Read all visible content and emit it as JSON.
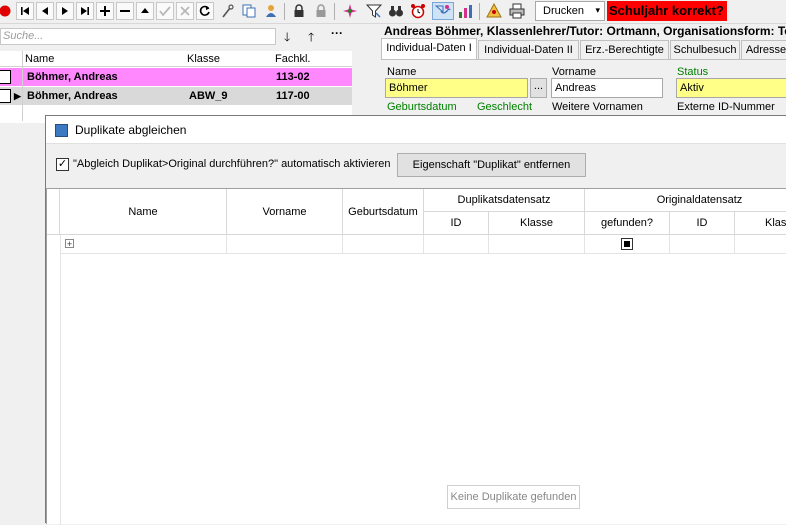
{
  "toolbar": {
    "print_label": "Drucken",
    "warning_text": "Schuljahr korrekt?",
    "icons": [
      "record-icon",
      "first-icon",
      "prev-icon",
      "next-icon",
      "last-icon",
      "add-icon",
      "delete-icon",
      "up-icon",
      "confirm-icon",
      "cancel-icon",
      "refresh-icon",
      "tools-icon",
      "copy-icon",
      "user-icon",
      "lock-icon",
      "lock-gray-icon",
      "sparkle-icon",
      "filter-icon",
      "binoculars-icon",
      "alarm-icon",
      "duplicate-icon",
      "chart-icon",
      "report-icon",
      "printer-icon",
      "dropdown-icon"
    ]
  },
  "left_panel": {
    "search_placeholder": "Suche...",
    "columns": {
      "name": "Name",
      "klasse": "Klasse",
      "fachkl": "Fachkl."
    },
    "rows": [
      {
        "name": "Böhmer, Andreas",
        "klasse": "",
        "fachkl": "113-02"
      },
      {
        "name": "Böhmer, Andreas",
        "klasse": "ABW_9",
        "fachkl": "117-00"
      }
    ]
  },
  "student": {
    "title": "Andreas Böhmer, Klassenlehrer/Tutor: Ortmann, Organisationsform: Te",
    "tabs": [
      "Individual-Daten I",
      "Individual-Daten II",
      "Erz.-Berechtigte",
      "Schulbesuch",
      "Adresse"
    ],
    "name_label": "Name",
    "name_value": "Böhmer",
    "ellipsis": "...",
    "vorname_label": "Vorname",
    "vorname_value": "Andreas",
    "status_label": "Status",
    "status_value": "Aktiv",
    "geburtsdatum_label": "Geburtsdatum",
    "geschlecht_label": "Geschlecht",
    "weitere_label": "Weitere Vornamen",
    "extern_label": "Externe ID-Nummer"
  },
  "dialog": {
    "title": "Duplikate abgleichen",
    "checkbox_label": "\"Abgleich Duplikat>Original durchführen?\" automatisch aktivieren",
    "checkbox_mark": "✓",
    "remove_button": "Eigenschaft \"Duplikat\" entfernen",
    "columns": {
      "name": "Name",
      "vorname": "Vorname",
      "geburtsdatum": "Geburtsdatum",
      "dup_group": "Duplikatsdatensatz",
      "dup_id": "ID",
      "dup_klasse": "Klasse",
      "orig_group": "Originaldatensatz",
      "orig_found": "gefunden?",
      "orig_id": "ID",
      "orig_klasse": "Klasse"
    },
    "expand_symbol": "+",
    "empty_text": "Keine Duplikate gefunden"
  },
  "colors": {
    "selected_row": "#ff88ff",
    "second_row": "#d9d9d9",
    "warning_bg": "#ff0000",
    "field_yellow": "#ffff88",
    "label_green": "#008000"
  }
}
